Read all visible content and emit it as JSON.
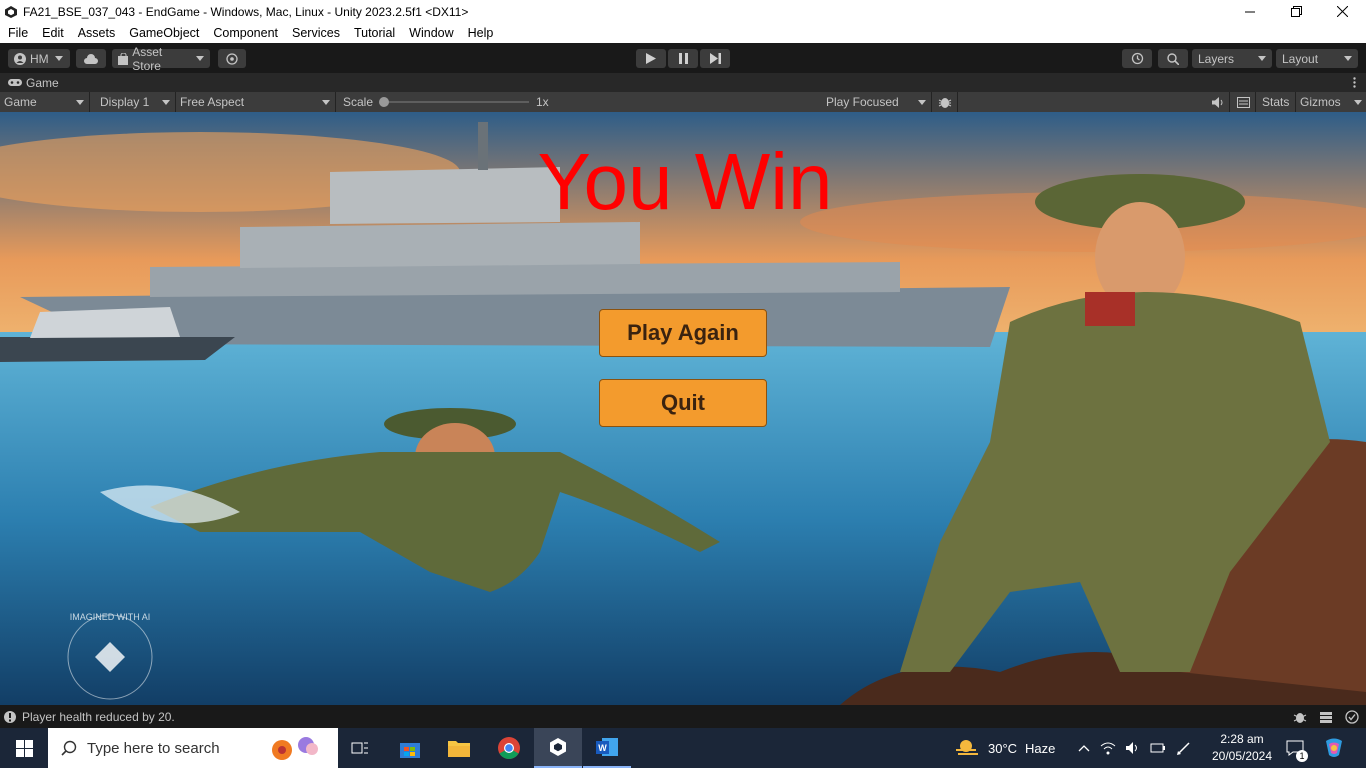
{
  "window": {
    "title": "FA21_BSE_037_043 - EndGame - Windows, Mac, Linux - Unity 2023.2.5f1 <DX11>",
    "minimize_icon": "minimize-icon",
    "maximize_icon": "restore-icon",
    "close_icon": "close-icon"
  },
  "menubar": [
    "File",
    "Edit",
    "Assets",
    "GameObject",
    "Component",
    "Services",
    "Tutorial",
    "Window",
    "Help"
  ],
  "toolbar": {
    "account_label": "HM",
    "asset_store_label": "Asset Store",
    "layers_label": "Layers",
    "layout_label": "Layout"
  },
  "game_tab": {
    "tab_label": "Game",
    "view_select": "Game",
    "display_select": "Display 1",
    "aspect_select": "Free Aspect",
    "scale_label": "Scale",
    "scale_value": "1x",
    "scale_level": 0.0,
    "play_mode_select": "Play Focused",
    "stats_label": "Stats",
    "gizmos_label": "Gizmos"
  },
  "game": {
    "title": "You Win",
    "play_again_label": "Play Again",
    "quit_label": "Quit",
    "watermark_text": "IMAGINED WITH AI"
  },
  "statusbar": {
    "message": "Player health reduced by 20."
  },
  "taskbar": {
    "search_placeholder": "Type here to search",
    "weather_temp": "30°C",
    "weather_desc": "Haze",
    "time": "2:28 am",
    "date": "20/05/2024",
    "notification_count": "1"
  },
  "colors": {
    "title_red": "#ff0000",
    "button_orange": "#f39b2d",
    "editor_dark": "#191919",
    "taskbar_bg": "#1b2638"
  }
}
